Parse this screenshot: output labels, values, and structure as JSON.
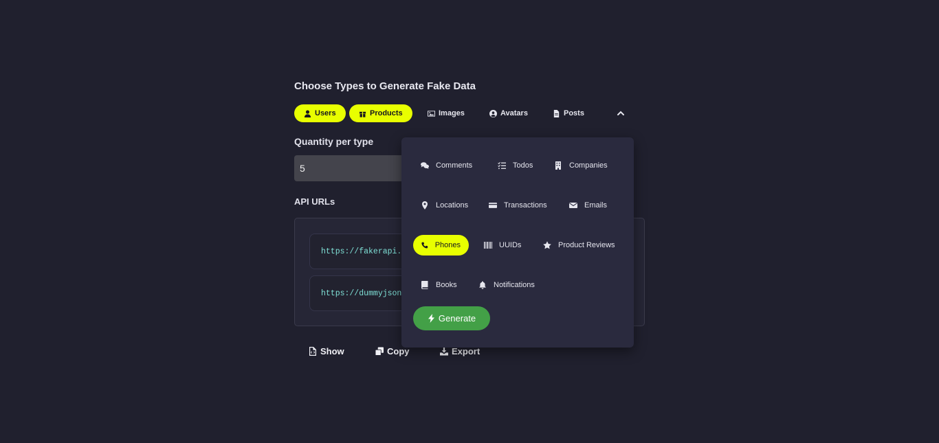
{
  "header": {
    "title": "Choose Types to Generate Fake Data"
  },
  "types": [
    {
      "label": "Users",
      "icon": "user-icon",
      "active": true
    },
    {
      "label": "Products",
      "icon": "gift-icon",
      "active": true
    },
    {
      "label": "Images",
      "icon": "image-icon",
      "active": false
    },
    {
      "label": "Avatars",
      "icon": "user-circle-icon",
      "active": false
    },
    {
      "label": "Posts",
      "icon": "file-icon",
      "active": false
    }
  ],
  "quantity": {
    "label": "Quantity per type",
    "value": "5"
  },
  "api": {
    "label": "API URLs",
    "urls": [
      "https://fakerapi.i",
      "https://dummyjson."
    ]
  },
  "actions": {
    "show": "Show",
    "copy": "Copy",
    "export": "Export"
  },
  "dropdown": {
    "items": [
      {
        "label": "Comments",
        "icon": "comments-icon",
        "active": false
      },
      {
        "label": "Todos",
        "icon": "list-check-icon",
        "active": false
      },
      {
        "label": "Companies",
        "icon": "building-icon",
        "active": false
      },
      {
        "label": "Locations",
        "icon": "map-pin-icon",
        "active": false
      },
      {
        "label": "Transactions",
        "icon": "credit-card-icon",
        "active": false
      },
      {
        "label": "Emails",
        "icon": "envelope-icon",
        "active": false
      },
      {
        "label": "Phones",
        "icon": "phone-icon",
        "active": true
      },
      {
        "label": "UUIDs",
        "icon": "barcode-icon",
        "active": false
      },
      {
        "label": "Product Reviews",
        "icon": "star-icon",
        "active": false
      },
      {
        "label": "Books",
        "icon": "book-icon",
        "active": false
      },
      {
        "label": "Notifications",
        "icon": "bell-icon",
        "active": false
      }
    ],
    "generate": "Generate"
  },
  "colors": {
    "accent": "#e8ff00",
    "background": "#20202e",
    "panel": "#2a2a3e",
    "generate": "#43a047",
    "url_text": "#7fe0d6"
  }
}
